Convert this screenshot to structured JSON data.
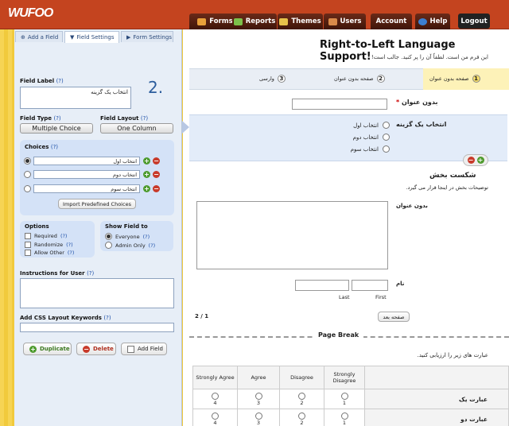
{
  "header": {
    "logo": "WUFOO",
    "nav": [
      "Forms",
      "Reports",
      "Themes",
      "Users"
    ],
    "account": "Account",
    "help": "Help",
    "logout": "Logout"
  },
  "left": {
    "tabs": [
      "Add a Field",
      "Field Settings",
      "Form Settings"
    ],
    "step": "2.",
    "field_label": {
      "label": "Field Label",
      "help": "(?)",
      "value": "انتخاب یک گزینه"
    },
    "field_type": {
      "label": "Field Type",
      "help": "(?)",
      "value": "Multiple Choice"
    },
    "field_layout": {
      "label": "Field Layout",
      "help": "(?)",
      "value": "One Column"
    },
    "choices": {
      "label": "Choices",
      "help": "(?)",
      "items": [
        "انتخاب اول",
        "انتخاب دوم",
        "انتخاب سوم"
      ],
      "import": "Import Predefined Choices"
    },
    "options": {
      "label": "Options",
      "items": [
        "Required",
        "Randomize",
        "Allow Other"
      ],
      "help": "(?)"
    },
    "show_field": {
      "label": "Show Field to",
      "items": [
        "Everyone",
        "Admin Only"
      ],
      "help": "(?)"
    },
    "instructions": {
      "label": "Instructions for User",
      "help": "(?)"
    },
    "css": {
      "label": "Add CSS Layout Keywords",
      "help": "(?)"
    },
    "buttons": [
      "Duplicate",
      "Delete",
      "Add Field"
    ]
  },
  "form": {
    "title": "Right-to-Left Language Support!",
    "description": "این فرم من است. لطفاً آن را پر کنید. جالب است!",
    "steps": [
      {
        "num": "1",
        "label": "صفحه بدون عنوان"
      },
      {
        "num": "2",
        "label": "صفحه بدون عنوان"
      },
      {
        "num": "3",
        "label": "وارسی"
      }
    ],
    "untitled_label": "بدون عنوان",
    "required_mark": "*",
    "choice_label": "انتخاب یک گزینه",
    "choices": [
      "انتخاب اول",
      "انتخاب دوم",
      "انتخاب سوم"
    ],
    "section_title": "شکست بخش",
    "section_desc": "توضیحات بخش در اینجا قرار می گیرد.",
    "textarea_label": "بدون عنوان",
    "name_label": "نام",
    "last": "Last",
    "first": "First",
    "page_count": "2 / 1",
    "next_button": "صفحه بعد",
    "page_break": "Page Break",
    "likert_prompt": "عبارت های زیر را ارزیابی کنید.",
    "likert_cols": [
      "Strongly Agree",
      "Agree",
      "Disagree",
      "Strongly Disagree"
    ],
    "likert_rows": [
      "عبارت یک",
      "عبارت دو"
    ],
    "likert_vals": [
      "4",
      "3",
      "2",
      "1"
    ]
  }
}
